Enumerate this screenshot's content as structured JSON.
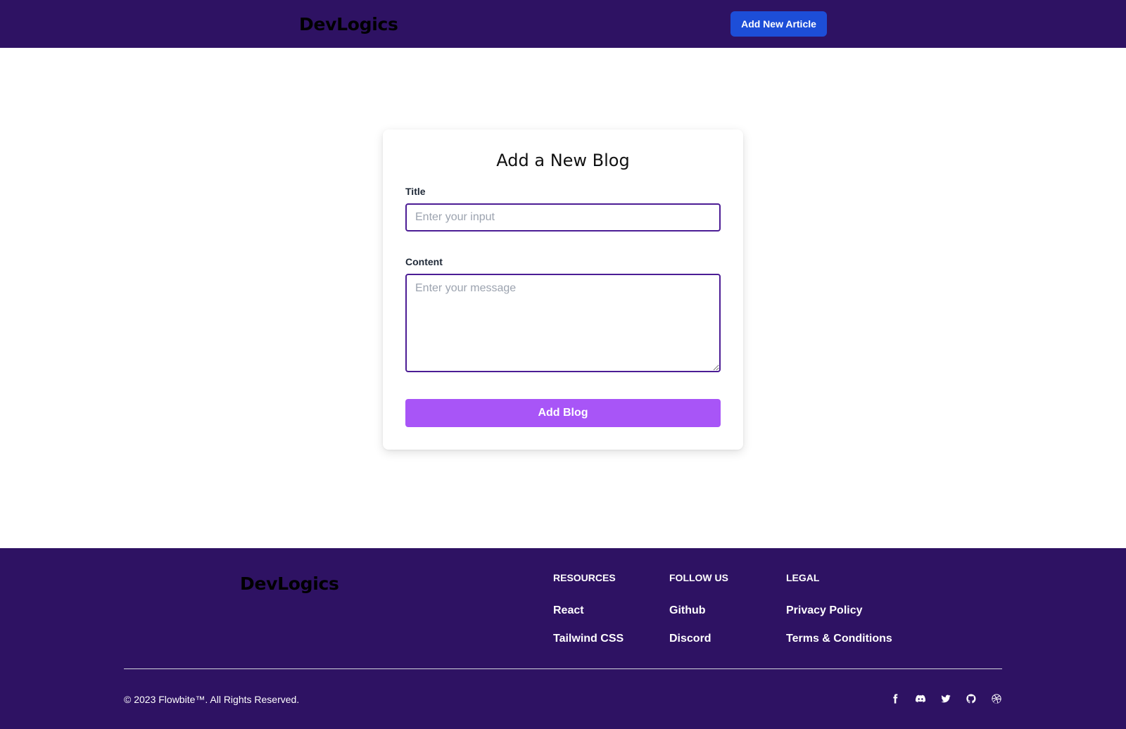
{
  "header": {
    "brand": "DevLogics",
    "add_article_label": "Add New Article"
  },
  "form": {
    "heading": "Add a New Blog",
    "title_label": "Title",
    "title_placeholder": "Enter your input",
    "title_value": "",
    "content_label": "Content",
    "content_placeholder": "Enter your message",
    "content_value": "",
    "submit_label": "Add Blog"
  },
  "footer": {
    "brand": "DevLogics",
    "columns": [
      {
        "heading": "RESOURCES",
        "links": [
          "React",
          "Tailwind CSS"
        ]
      },
      {
        "heading": "FOLLOW US",
        "links": [
          "Github",
          "Discord"
        ]
      },
      {
        "heading": "LEGAL",
        "links": [
          "Privacy Policy",
          "Terms & Conditions"
        ]
      }
    ],
    "copyright": "© 2023 Flowbite™. All Rights Reserved.",
    "social_icons": [
      "facebook-icon",
      "discord-icon",
      "twitter-icon",
      "github-icon",
      "dribbble-icon"
    ]
  },
  "colors": {
    "nav_background": "#2e1263",
    "primary_button": "#1d4ed8",
    "submit_button": "#a855f7",
    "input_border": "#4c1d95"
  }
}
